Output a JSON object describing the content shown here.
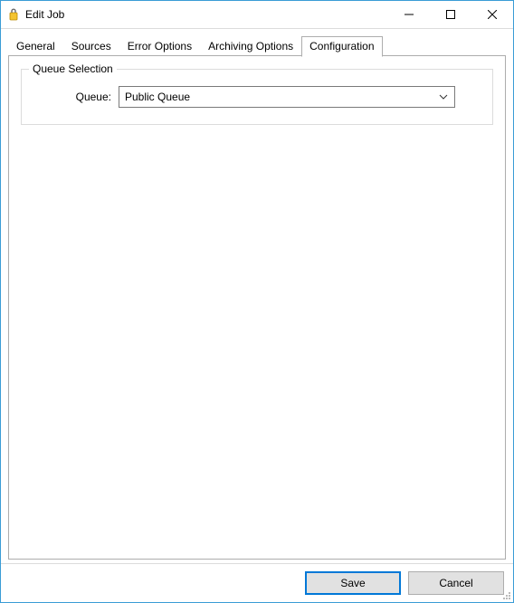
{
  "window": {
    "title": "Edit Job"
  },
  "tabs": [
    {
      "label": "General"
    },
    {
      "label": "Sources"
    },
    {
      "label": "Error Options"
    },
    {
      "label": "Archiving Options"
    },
    {
      "label": "Configuration"
    }
  ],
  "active_tab_index": 4,
  "group": {
    "legend": "Queue Selection",
    "queue_label": "Queue:",
    "queue_value": "Public Queue"
  },
  "buttons": {
    "save": "Save",
    "cancel": "Cancel"
  }
}
